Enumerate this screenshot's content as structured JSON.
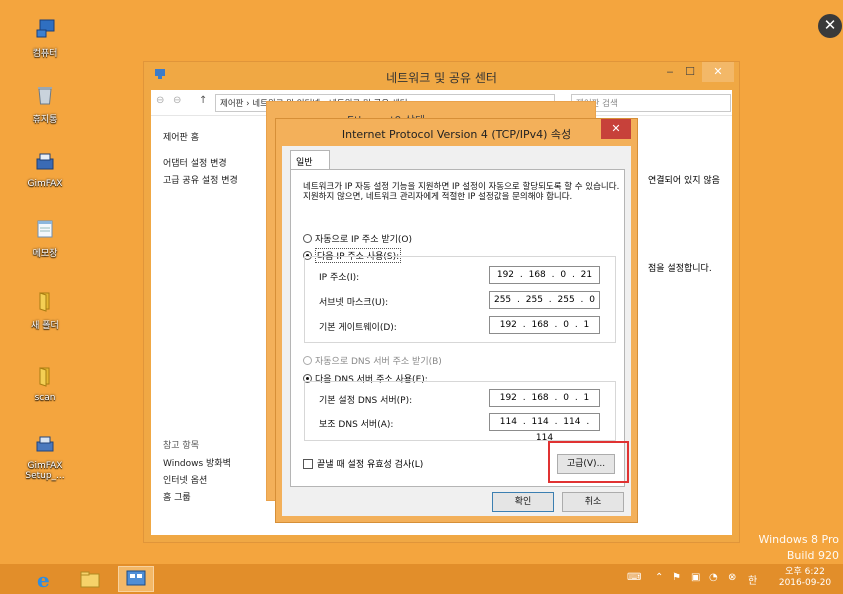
{
  "desktop": {
    "icons": [
      {
        "label": "컴퓨터",
        "icon": "computer-icon"
      },
      {
        "label": "휴지통",
        "icon": "recycle-bin-icon"
      },
      {
        "label": "GimFAX",
        "icon": "fax-app-icon"
      },
      {
        "label": "메모장",
        "icon": "notepad-icon"
      },
      {
        "label": "새 폴더",
        "icon": "folder-icon"
      },
      {
        "label": "scan",
        "icon": "folder-icon"
      },
      {
        "label": "GimFAX Setup_...",
        "icon": "setup-icon"
      }
    ],
    "watermark_line1": "Windows 8 Pro",
    "watermark_line2": "Build 920"
  },
  "network_window": {
    "title": "네트워크 및 공유 센터",
    "breadcrumb": "제어판 › 네트워크 및 인터넷 › 네트워크 및 공유 센터",
    "search_placeholder": "제어판 검색",
    "nav_home": "제어판 홈",
    "nav_adapter": "어댑터 설정 변경",
    "nav_sharing": "고급 공유 설정 변경",
    "see_also": "참고 항목",
    "see_also_items": [
      "Windows 방화벽",
      "인터넷 옵션",
      "홈 그룹"
    ],
    "right_text1": "연결되어 있지 않음",
    "right_text2": "점을 설정합니다."
  },
  "ethernet_dialog": {
    "title": "Ethernet0 상태"
  },
  "ipv4_dialog": {
    "title": "Internet Protocol Version 4 (TCP/IPv4) 속성",
    "help": "?",
    "tab_general": "일반",
    "description": "네트워크가 IP 자동 설정 기능을 지원하면 IP 설정이 자동으로 할당되도록 할 수 있습니다. 지원하지 않으면, 네트워크 관리자에게 적절한 IP 설정값을 문의해야 합니다.",
    "auto_ip_label": "자동으로 IP 주소 받기(O)",
    "manual_ip_label": "다음 IP 주소 사용(S):",
    "ip_label": "IP 주소(I):",
    "ip_value": "192 . 168 . 0 . 21",
    "subnet_label": "서브넷 마스크(U):",
    "subnet_value": "255 . 255 . 255 . 0",
    "gateway_label": "기본 게이트웨이(D):",
    "gateway_value": "192 . 168 . 0 . 1",
    "auto_dns_label": "자동으로 DNS 서버 주소 받기(B)",
    "manual_dns_label": "다음 DNS 서버 주소 사용(E):",
    "preferred_dns_label": "기본 설정 DNS 서버(P):",
    "preferred_dns_value": "192 . 168 . 0 . 1",
    "alternate_dns_label": "보조 DNS 서버(A):",
    "alternate_dns_value": "114 . 114 . 114 . 114",
    "validate_label": "끝낼 때 설정 유효성 검사(L)",
    "advanced_button": "고급(V)...",
    "ok_button": "확인",
    "cancel_button": "취소"
  },
  "taskbar": {
    "time": "오후 6:22",
    "date": "2016-09-20",
    "ime": "한"
  },
  "colors": {
    "desktop": "#f4a53e",
    "window_frame": "#f0a844",
    "highlight_box": "#e03232"
  }
}
